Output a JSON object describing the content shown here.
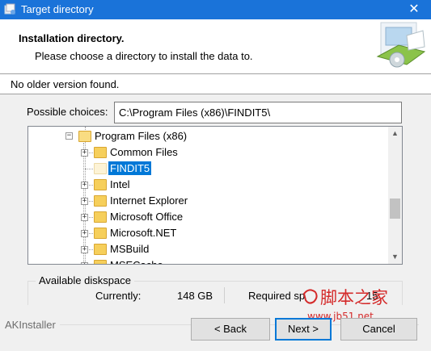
{
  "window": {
    "title": "Target directory",
    "close_glyph": "✕"
  },
  "header": {
    "title": "Installation directory.",
    "subtitle": "Please choose a directory to install the data to."
  },
  "status": {
    "text": "No older version found."
  },
  "choices": {
    "label": "Possible choices:",
    "value": "C:\\Program Files (x86)\\FINDIT5\\"
  },
  "tree": {
    "parent": {
      "label": "Program Files (x86)",
      "expander": "−"
    },
    "items": [
      {
        "label": "Common Files",
        "expander": "+",
        "selected": false
      },
      {
        "label": "FINDIT5",
        "expander": "",
        "selected": true
      },
      {
        "label": "Intel",
        "expander": "+",
        "selected": false
      },
      {
        "label": "Internet Explorer",
        "expander": "+",
        "selected": false
      },
      {
        "label": "Microsoft Office",
        "expander": "+",
        "selected": false
      },
      {
        "label": "Microsoft.NET",
        "expander": "+",
        "selected": false
      },
      {
        "label": "MSBuild",
        "expander": "+",
        "selected": false
      },
      {
        "label": "MSECache",
        "expander": "+",
        "selected": false
      }
    ],
    "scroll_up": "▲",
    "scroll_down": "▼"
  },
  "diskspace": {
    "legend": "Available diskspace",
    "current_label": "Currently:",
    "current_value": "148 GB",
    "required_label": "Required sp",
    "required_value": "15",
    "watermark_main": "脚本之家",
    "watermark_url": "www.jb51.net"
  },
  "footer": {
    "brand": "AKInstaller",
    "back_label": "< Back",
    "next_label": "Next >",
    "cancel_label": "Cancel"
  },
  "colors": {
    "titlebar": "#1a73d9",
    "selection": "#0078d7",
    "watermark": "#d42a2a"
  }
}
